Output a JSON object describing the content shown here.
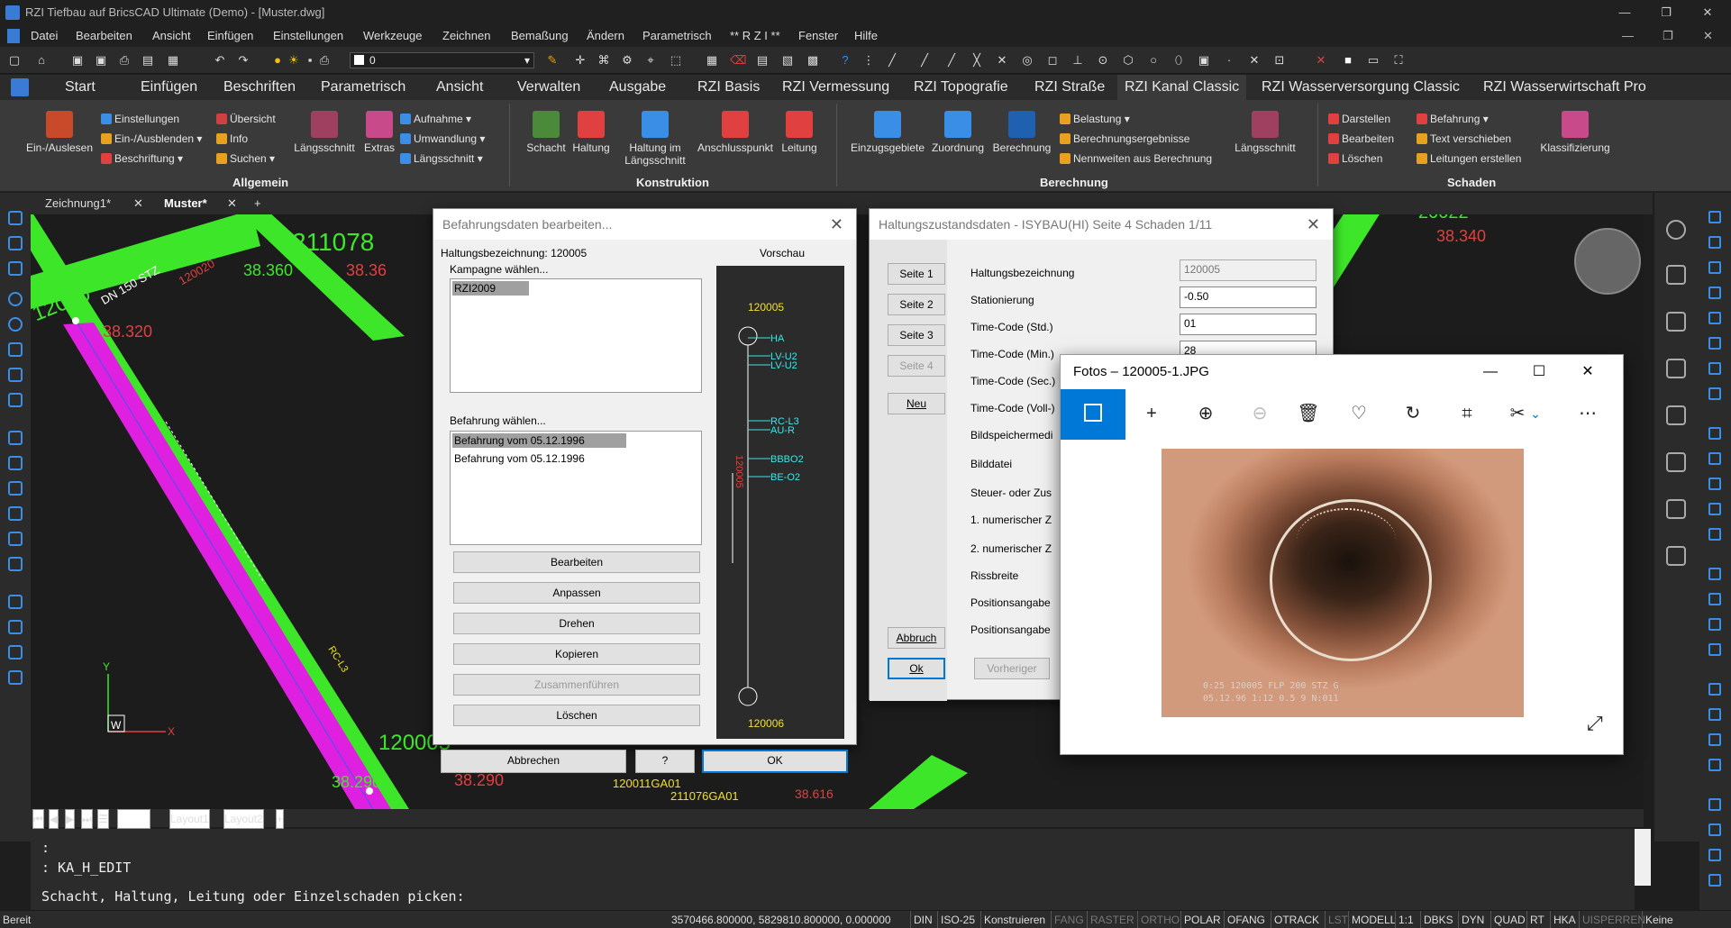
{
  "title": "RZI Tiefbau auf BricsCAD Ultimate (Demo) - [Muster.dwg]",
  "menu": [
    "Datei",
    "Bearbeiten",
    "Ansicht",
    "Einfügen",
    "Einstellungen",
    "Werkzeuge",
    "Zeichnen",
    "Bemaßung",
    "Ändern",
    "Parametrisch",
    "** R Z I **",
    "Fenster",
    "Hilfe"
  ],
  "layer_value": "0",
  "tabs": [
    "Start",
    "Einfügen",
    "Beschriften",
    "Parametrisch",
    "Ansicht",
    "Verwalten",
    "Ausgabe",
    "RZI Basis",
    "RZI Vermessung",
    "RZI Topografie",
    "RZI Straße",
    "RZI Kanal Classic",
    "RZI Wasserversorgung Classic",
    "RZI Wasserwirtschaft Pro"
  ],
  "ribbon": {
    "allgemein": {
      "big": [
        "Ein-/Auslesen",
        "Längsschnitt",
        "Extras"
      ],
      "small": [
        "Einstellungen",
        "Ein-/Ausblenden",
        "Beschriftung",
        "Übersicht",
        "Info",
        "Suchen",
        "Aufnahme",
        "Umwandlung",
        "Längsschnitt"
      ],
      "label": "Allgemein"
    },
    "konstruktion": {
      "big": [
        "Schacht",
        "Haltung",
        "Haltung im Längsschnitt",
        "Anschlusspunkt",
        "Leitung"
      ],
      "label": "Konstruktion"
    },
    "berechnung": {
      "big": [
        "Einzugsgebiete",
        "Zuordnung",
        "Berechnung"
      ],
      "small": [
        "Belastung",
        "Berechnungsergebnisse",
        "Nennweiten aus Berechnung"
      ],
      "lengthcut": "Längsschnitt",
      "label": "Berechnung"
    },
    "schaden": {
      "small": [
        "Darstellen",
        "Bearbeiten",
        "Löschen",
        "Befahrung",
        "Text verschieben",
        "Leitungen erstellen"
      ],
      "big": [
        "Klassifizierung"
      ],
      "label": "Schaden"
    }
  },
  "doctabs": [
    "Zeichnung1*",
    "Muster*"
  ],
  "canvas_labels": {
    "l1": "211078",
    "l2": "38.360",
    "l3": "38.36",
    "l4": "38.320",
    "l5": "DN 150 STZ",
    "l6": "120020",
    "l7": "12000",
    "l8": "38.340",
    "l9": "120005",
    "l10": "38.290",
    "l11": "38.290",
    "l12": "120011GA01",
    "l13": "211076GA01",
    "l14": "38.616",
    "l15": "W",
    "l16": "Y",
    "l17": "X",
    "l18": "20022",
    "l19": "RC-L3"
  },
  "layouttabs": [
    "Model",
    "Layout1",
    "Layout2"
  ],
  "cmd": {
    "line1": ":",
    "line2": ": KA_H_EDIT",
    "prompt": "Schacht, Haltung, Leitung oder Einzelschaden picken:"
  },
  "status": {
    "ready": "Bereit",
    "coords": "3570466.800000, 5829810.800000, 0.000000",
    "items": [
      "DIN",
      "ISO-25",
      "Konstruieren",
      "FANG",
      "RASTER",
      "ORTHO",
      "POLAR",
      "OFANG",
      "OTRACK",
      "LST",
      "MODELL",
      "1:1",
      "DBKS",
      "DYN",
      "QUAD",
      "RT",
      "HKA",
      "UISPERREN",
      "Keine"
    ]
  },
  "dlg1": {
    "title": "Befahrungsdaten bearbeiten...",
    "haltung": "Haltungsbezeichnung: 120005",
    "vorschau": "Vorschau",
    "kampagne_label": "Kampagne wählen...",
    "kampagne_items": [
      "RZI2009"
    ],
    "befahrung_label": "Befahrung wählen...",
    "befahrung_items": [
      "Befahrung vom 05.12.1996",
      "Befahrung vom 05.12.1996"
    ],
    "buttons": [
      "Bearbeiten",
      "Anpassen",
      "Drehen",
      "Kopieren",
      "Zusammenführen",
      "Löschen"
    ],
    "abbrechen": "Abbrechen",
    "help": "?",
    "ok": "OK",
    "preview": {
      "top": "120005",
      "bottom": "120006",
      "vertical": "120005",
      "codes": [
        "HA",
        "LV-U2",
        "LV-U2",
        "RC-L3",
        "AU-R",
        "BBBO2",
        "BE-O2"
      ]
    }
  },
  "dlg2": {
    "title": "Haltungszustandsdaten - ISYBAU(HI) Seite 4  Schaden 1/11",
    "pages": [
      "Seite 1",
      "Seite 2",
      "Seite 3",
      "Seite 4"
    ],
    "neu": "Neu",
    "abbruch": "Abbruch",
    "ok": "Ok",
    "vorheriger": "Vorheriger",
    "fields": [
      "Haltungsbezeichnung",
      "Stationierung",
      "Time-Code (Std.)",
      "Time-Code (Min.)",
      "Time-Code (Sec.)",
      "Time-Code (Voll-)",
      "Bildspeichermedi",
      "Bilddatei",
      "Steuer- oder Zus",
      "1. numerischer Z",
      "2. numerischer Z",
      "Rissbreite",
      "Positionsangabe",
      "Positionsangabe"
    ],
    "values": [
      "120005",
      "-0.50",
      "01",
      "28"
    ]
  },
  "photos": {
    "title": "Fotos – 120005-1.JPG",
    "caption1": "0:25  120005 FLP  200 STZ G",
    "caption2": "05.12.96  1:12  0.5  9  N:011"
  }
}
